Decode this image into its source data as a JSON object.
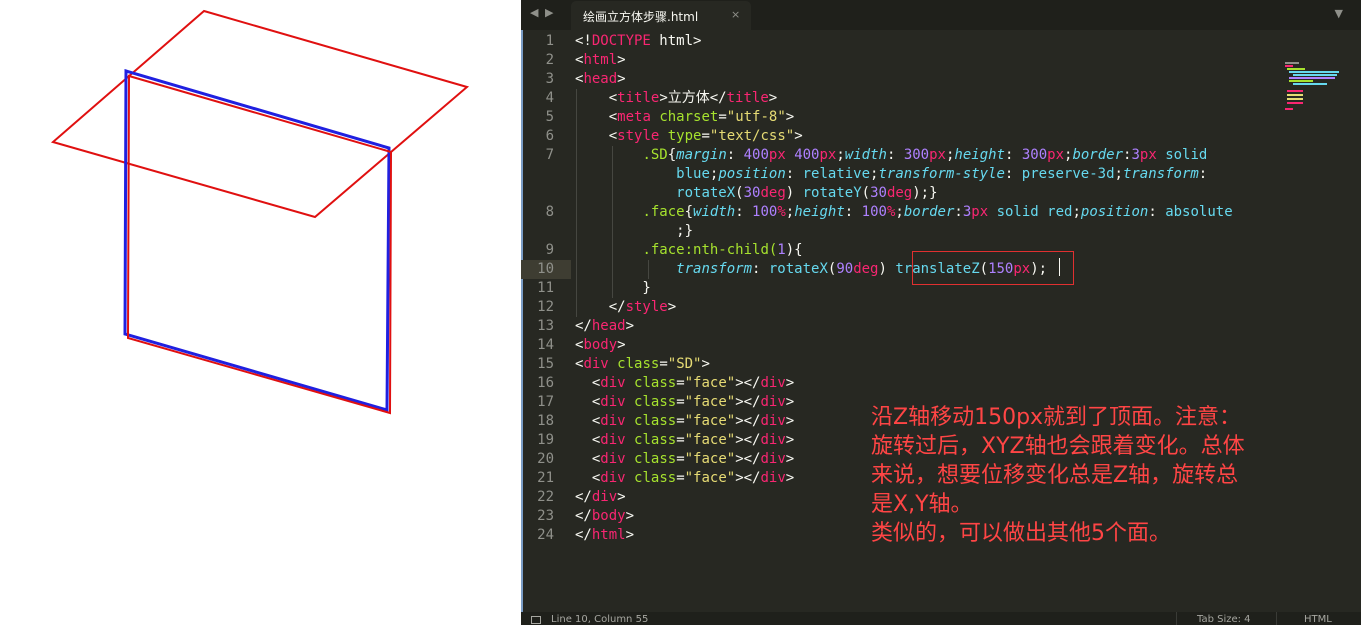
{
  "editor": {
    "tab": {
      "title": "绘画立方体步骤.html",
      "close_icon": "×"
    },
    "nav": {
      "back_icon": "◀",
      "forward_icon": "▶",
      "dropdown_icon": "▼"
    },
    "lines": [
      "1",
      "2",
      "3",
      "4",
      "5",
      "6",
      "7",
      "",
      "",
      "8",
      "",
      "9",
      "10",
      "11",
      "12",
      "13",
      "14",
      "15",
      "16",
      "17",
      "18",
      "19",
      "20",
      "21",
      "22",
      "23",
      "24"
    ],
    "current_line": "10",
    "annotation": {
      "text": "沿Z轴移动150px就到了顶面。注意：\n旋转过后，XYZ轴也会跟着变化。总体\n来说，想要位移变化总是Z轴，旋转总\n是X,Y轴。\n类似的，可以做出其他5个面。"
    }
  },
  "code": {
    "l1_doctype_open": "<!",
    "l1_doctype": "DOCTYPE",
    "l1_rest": " html>",
    "html_tag": "html",
    "head_tag": "head",
    "title_tag": "title",
    "title_text": "立方体",
    "meta_tag": "meta",
    "charset_attr": "charset",
    "charset_val": "\"utf-8\"",
    "style_tag": "style",
    "type_attr": "type",
    "type_val": "\"text/css\"",
    "sd_selector": ".SD",
    "margin_prop": "margin",
    "margin_val1": "400",
    "margin_val2": "400",
    "width_prop": "width",
    "width_val": "300",
    "height_prop": "height",
    "height_val": "300",
    "border_prop": "border",
    "border_val": "3",
    "solid_kw": "solid",
    "blue_kw": "blue",
    "position_prop": "position",
    "relative_kw": "relative",
    "ts_prop": "transform-style",
    "preserve_kw": "preserve-3d",
    "transform_prop": "transform",
    "rotatex_fn": "rotateX",
    "rot_x_val": "30",
    "rotatey_fn": "rotateY",
    "rot_y_val": "30",
    "deg_unit": "deg",
    "px_unit": "px",
    "pct_unit": "%",
    "face_selector": ".face",
    "face_width_val": "100",
    "face_height_val": "100",
    "face_border_val": "3",
    "red_kw": "red",
    "absolute_kw": "absolute",
    "nth_selector": ".face:nth-child(",
    "nth_num": "1",
    "l10_rot_val": "90",
    "translatez_fn": "translateZ",
    "tz_val": "150",
    "div_tag": "div",
    "class_attr": "class",
    "sd_val": "\"SD\"",
    "face_val": "\"face\"",
    "body_tag": "body"
  },
  "status": {
    "position": "Line 10, Column 55",
    "tab_size": "Tab Size: 4",
    "syntax": "HTML"
  },
  "colors": {
    "editor_bg": "#272822",
    "keyword": "#f92672",
    "attribute": "#a6e22e",
    "string": "#e6db74",
    "number": "#ae81ff",
    "property": "#66d9ef",
    "annotation": "#ff4545",
    "cube_front": "#2020e0",
    "cube_face": "#e01010"
  }
}
